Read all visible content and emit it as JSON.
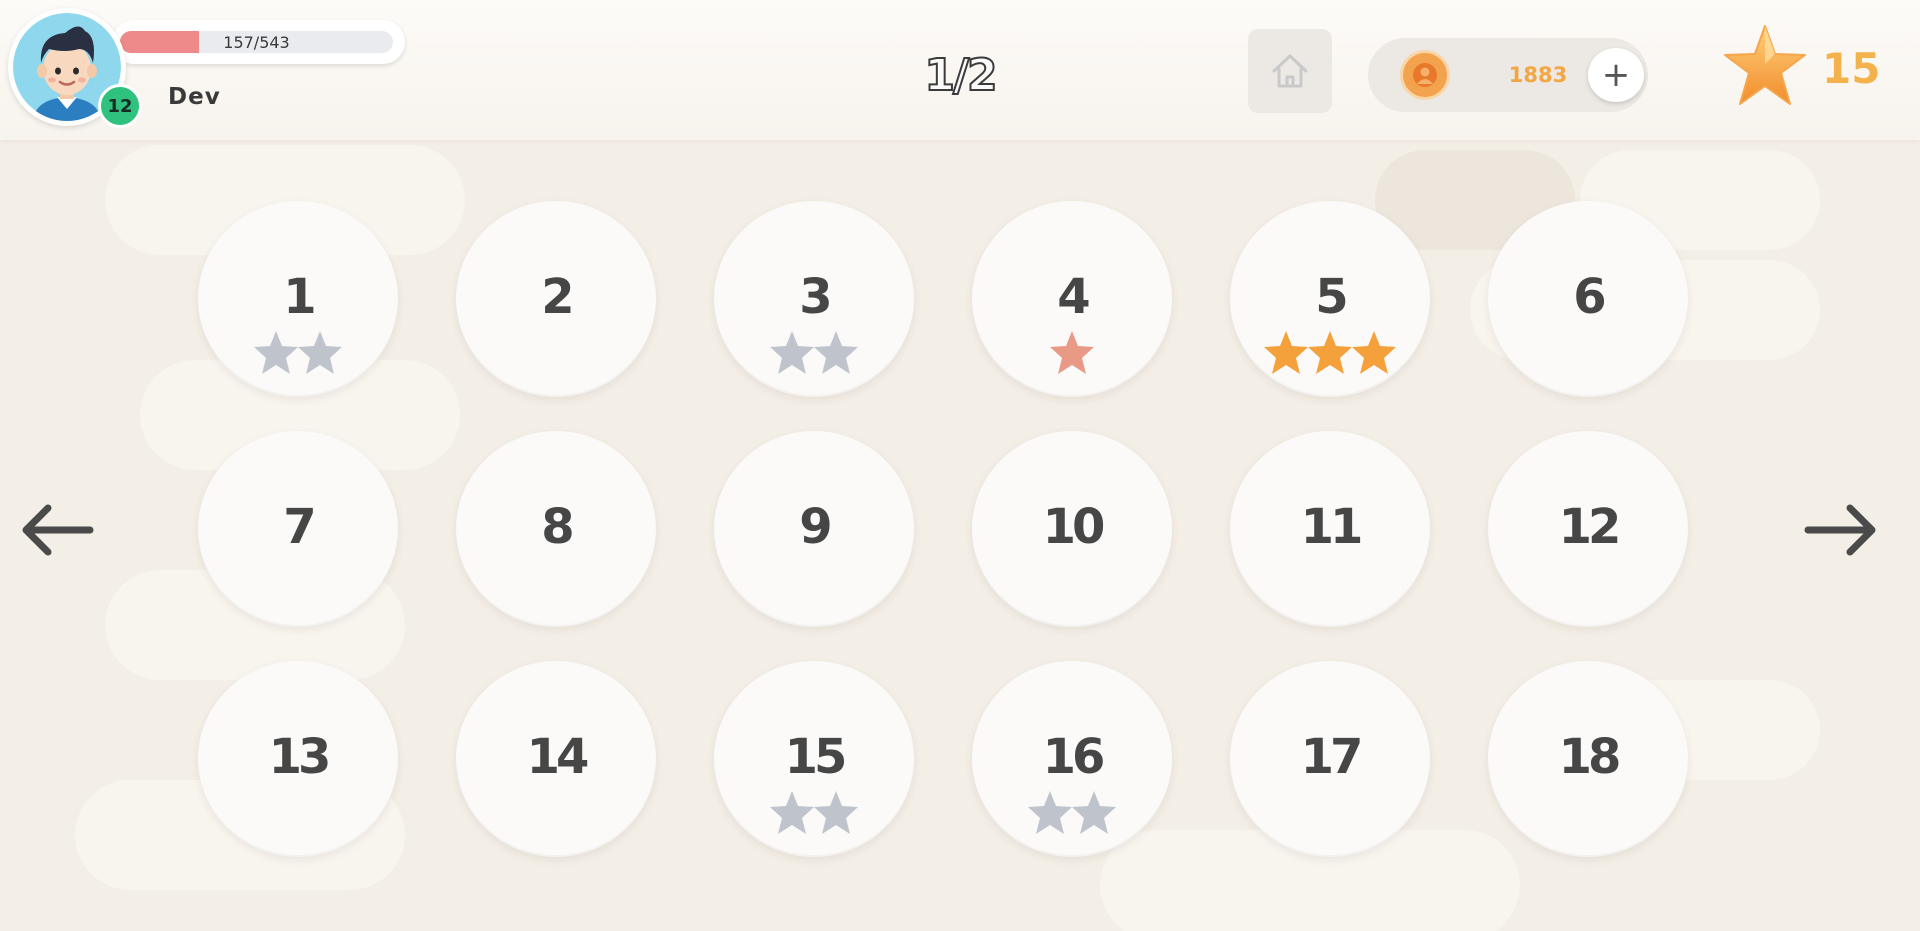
{
  "colors": {
    "background": "#f3eee6",
    "accent_orange": "#f5a13b",
    "star_gray": "#bfc4cc",
    "star_salmon": "#e89a87",
    "level_badge": "#2ec27e",
    "xp_fill": "#ef8a8a",
    "coin_text": "#f2a644"
  },
  "header": {
    "player": {
      "name": "Dev",
      "level": "12",
      "avatar_icon": "boy-avatar-icon"
    },
    "xp": {
      "text": "157/543",
      "current": 157,
      "max": 543
    },
    "page_indicator": "1/2",
    "home_icon": "home-icon",
    "coins": {
      "count": "1883",
      "icon": "coin-icon",
      "add_label": "+"
    },
    "total_stars": {
      "count": "15",
      "icon": "star-icon"
    }
  },
  "navigation": {
    "prev_icon": "arrow-left-icon",
    "next_icon": "arrow-right-icon"
  },
  "levels": [
    {
      "number": "1",
      "stars": 2,
      "style": "gray"
    },
    {
      "number": "2",
      "stars": 0,
      "style": "none"
    },
    {
      "number": "3",
      "stars": 2,
      "style": "gray"
    },
    {
      "number": "4",
      "stars": 1,
      "style": "salmon"
    },
    {
      "number": "5",
      "stars": 3,
      "style": "gold"
    },
    {
      "number": "6",
      "stars": 0,
      "style": "none"
    },
    {
      "number": "7",
      "stars": 0,
      "style": "none"
    },
    {
      "number": "8",
      "stars": 0,
      "style": "none"
    },
    {
      "number": "9",
      "stars": 0,
      "style": "none"
    },
    {
      "number": "10",
      "stars": 0,
      "style": "none"
    },
    {
      "number": "11",
      "stars": 0,
      "style": "none"
    },
    {
      "number": "12",
      "stars": 0,
      "style": "none"
    },
    {
      "number": "13",
      "stars": 0,
      "style": "none"
    },
    {
      "number": "14",
      "stars": 0,
      "style": "none"
    },
    {
      "number": "15",
      "stars": 2,
      "style": "gray"
    },
    {
      "number": "16",
      "stars": 2,
      "style": "gray"
    },
    {
      "number": "17",
      "stars": 0,
      "style": "none"
    },
    {
      "number": "18",
      "stars": 0,
      "style": "none"
    }
  ]
}
